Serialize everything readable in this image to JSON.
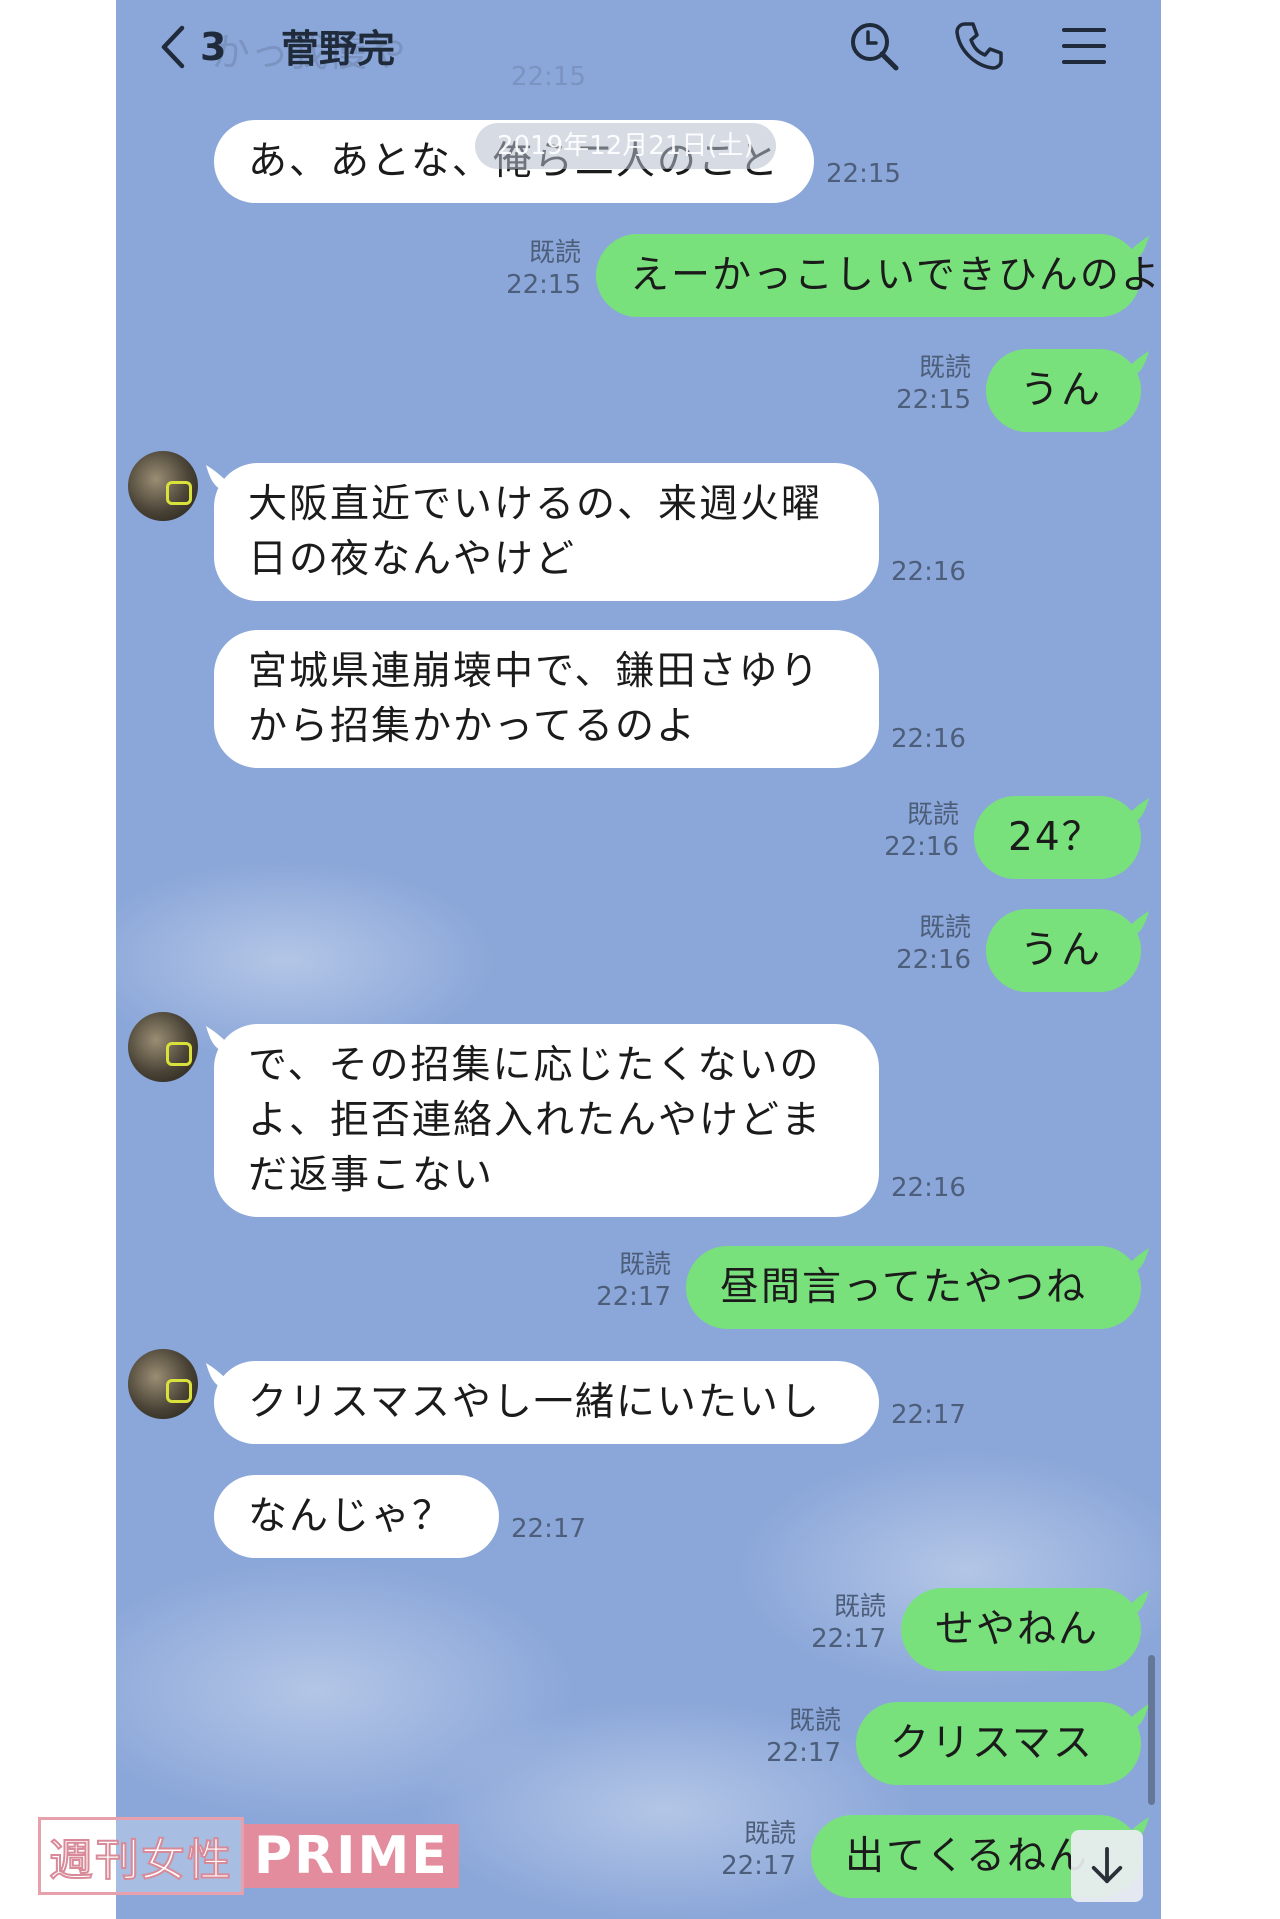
{
  "header": {
    "unread_count": "3",
    "title": "菅野完"
  },
  "ghost_top": {
    "text": "かっ我慢や",
    "time": "22:15"
  },
  "date_chip": "2019年12月21日(土)",
  "messages": [
    {
      "side": "left",
      "lines": [
        "あ、あとな、俺ら二人のこと"
      ],
      "time": "22:15"
    },
    {
      "side": "right",
      "lines": [
        "えーかっこしいできひんのよね"
      ],
      "read": "既読",
      "time": "22:15"
    },
    {
      "side": "right",
      "lines": [
        "うん"
      ],
      "read": "既読",
      "time": "22:15"
    },
    {
      "side": "left",
      "lines": [
        "大阪直近でいけるの、来週火曜",
        "日の夜なんやけど"
      ],
      "time": "22:16"
    },
    {
      "side": "left",
      "lines": [
        "宮城県連崩壊中で、鎌田さゆり",
        "から招集かかってるのよ"
      ],
      "time": "22:16"
    },
    {
      "side": "right",
      "lines": [
        "24？"
      ],
      "read": "既読",
      "time": "22:16"
    },
    {
      "side": "right",
      "lines": [
        "うん"
      ],
      "read": "既読",
      "time": "22:16"
    },
    {
      "side": "left",
      "lines": [
        "で、その招集に応じたくないの",
        "よ、拒否連絡入れたんやけどま",
        "だ返事こない"
      ],
      "time": "22:16"
    },
    {
      "side": "right",
      "lines": [
        "昼間言ってたやつね"
      ],
      "read": "既読",
      "time": "22:17"
    },
    {
      "side": "left",
      "lines": [
        "クリスマスやし一緒にいたいし"
      ],
      "time": "22:17"
    },
    {
      "side": "left",
      "lines": [
        "なんじゃ？"
      ],
      "time": "22:17"
    },
    {
      "side": "right",
      "lines": [
        "せやねん"
      ],
      "read": "既読",
      "time": "22:17"
    },
    {
      "side": "right",
      "lines": [
        "クリスマス"
      ],
      "read": "既読",
      "time": "22:17"
    },
    {
      "side": "right",
      "lines": [
        "出てくるねん"
      ],
      "read": "既読",
      "time": "22:17"
    }
  ],
  "watermark": {
    "jp": "週刊女性",
    "en": "PRIME"
  },
  "colors": {
    "background": "#8ba7d9",
    "bubble_out": "#79e17c",
    "bubble_in": "#ffffff"
  },
  "icons": [
    "back-chevron-icon",
    "search-icon",
    "phone-icon",
    "menu-icon",
    "arrow-down-icon"
  ]
}
